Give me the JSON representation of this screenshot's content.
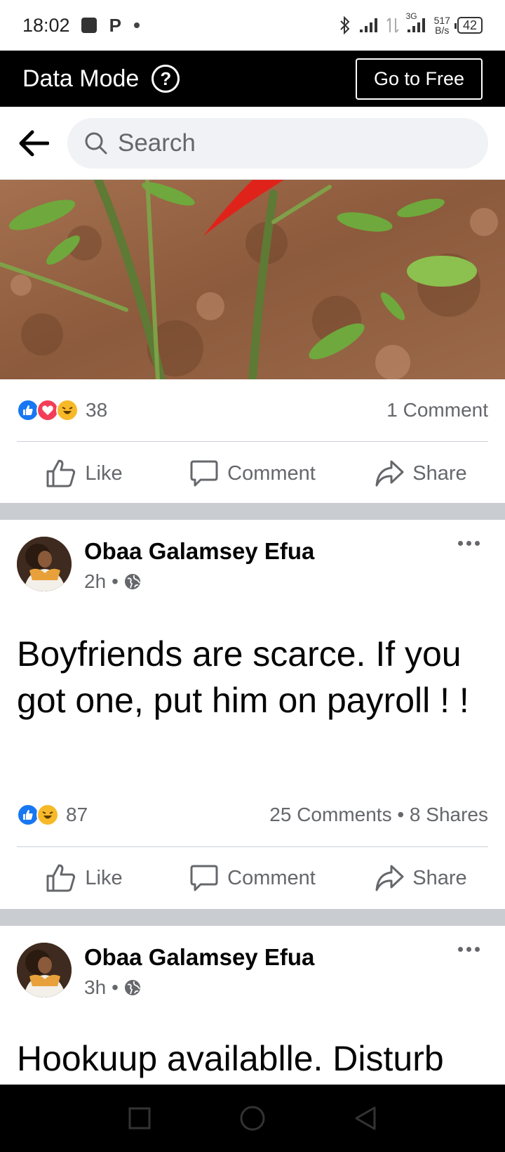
{
  "status_bar": {
    "time": "18:02",
    "p_label": "P",
    "network_label": "3G",
    "speed_value": "517",
    "speed_unit": "B/s",
    "battery": "42"
  },
  "data_mode": {
    "title": "Data Mode",
    "help_symbol": "?",
    "go_free_label": "Go to Free"
  },
  "search": {
    "placeholder": "Search"
  },
  "post1": {
    "reaction_count": "38",
    "comments": "1 Comment",
    "actions": {
      "like": "Like",
      "comment": "Comment",
      "share": "Share"
    }
  },
  "post2": {
    "author": "Obaa Galamsey Efua",
    "time": "2h",
    "separator": "•",
    "text": "Boyfriends are scarce. If you got one, put him on payroll ! !",
    "reaction_count": "87",
    "comments_shares": "25 Comments • 8 Shares",
    "actions": {
      "like": "Like",
      "comment": "Comment",
      "share": "Share"
    }
  },
  "post3": {
    "author": "Obaa Galamsey Efua",
    "time": "3h",
    "separator": "•",
    "text": "Hookuup availablle. Disturb"
  },
  "colors": {
    "accent": "#1877f2",
    "love": "#f33e58",
    "haha": "#f7b928",
    "secondary_text": "#65676b"
  },
  "icons": [
    "back-arrow-icon",
    "search-icon",
    "help-icon",
    "globe-icon",
    "like-icon",
    "comment-icon",
    "share-icon",
    "more-icon"
  ]
}
